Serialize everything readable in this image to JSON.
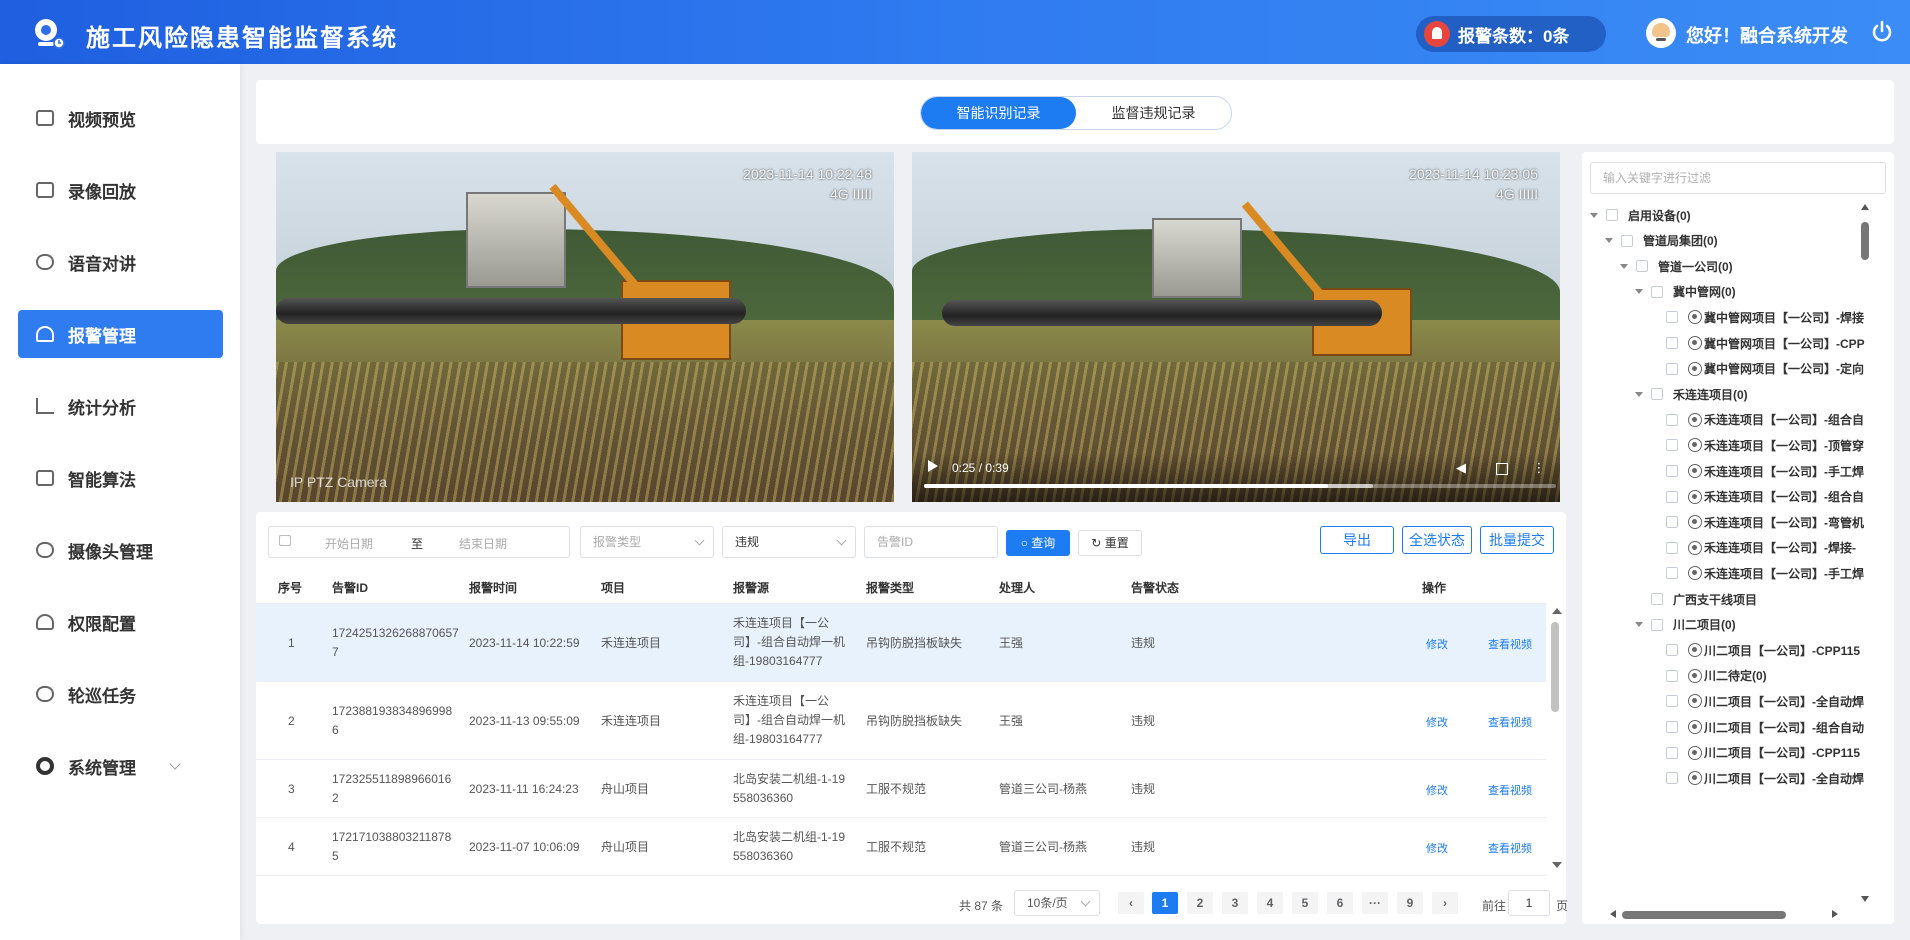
{
  "header": {
    "title": "施工风险隐患智能监督系统",
    "alarm_text": "报警条数：0条",
    "greeting": "您好！融合系统开发"
  },
  "sidebar": {
    "items": [
      {
        "label": "视频预览",
        "icon": "video-preview-icon"
      },
      {
        "label": "录像回放",
        "icon": "playback-icon"
      },
      {
        "label": "语音对讲",
        "icon": "microphone-icon"
      },
      {
        "label": "报警管理",
        "icon": "alarm-icon",
        "active": true
      },
      {
        "label": "统计分析",
        "icon": "bar-chart-icon"
      },
      {
        "label": "智能算法",
        "icon": "code-window-icon"
      },
      {
        "label": "摄像头管理",
        "icon": "camera-icon"
      },
      {
        "label": "权限配置",
        "icon": "user-icon"
      },
      {
        "label": "轮巡任务",
        "icon": "patrol-icon"
      },
      {
        "label": "系统管理",
        "icon": "gear-icon"
      }
    ]
  },
  "tabs": [
    {
      "label": "智能识别记录",
      "active": true
    },
    {
      "label": "监督违规记录",
      "active": false
    }
  ],
  "videos": [
    {
      "timestamp": "2023-11-14 10:22:48",
      "signal": "4G IIIII",
      "label": "IP PTZ Camera"
    },
    {
      "timestamp": "2023-11-14 10:23:05",
      "signal": "4G IIIII",
      "time": "0:25 / 0:39",
      "progress": 0.64,
      "buffered": 0.71
    }
  ],
  "filters": {
    "start_placeholder": "开始日期",
    "range_sep": "至",
    "end_placeholder": "结束日期",
    "type_placeholder": "报警类型",
    "status_value": "违规",
    "id_placeholder": "告警ID",
    "search_label": "查询",
    "reset_label": "重置",
    "export_label": "导出",
    "select_all_label": "全选状态",
    "batch_submit_label": "批量提交"
  },
  "table": {
    "columns": [
      "序号",
      "告警ID",
      "报警时间",
      "项目",
      "报警源",
      "报警类型",
      "处理人",
      "告警状态",
      "操作"
    ],
    "rows": [
      {
        "no": "1",
        "id": [
          "1724251326268870657",
          "7"
        ],
        "time": "2023-11-14 10:22:59",
        "project": "禾连连项目",
        "source": [
          "禾连连项目【一公",
          "司】-组合自动焊一机",
          "组-19803164777"
        ],
        "type": "吊钩防脱挡板缺失",
        "handler": "王强",
        "status": "违规",
        "highlight": true
      },
      {
        "no": "2",
        "id": [
          "172388193834896998",
          "6"
        ],
        "time": "2023-11-13 09:55:09",
        "project": "禾连连项目",
        "source": [
          "禾连连项目【一公",
          "司】-组合自动焊一机",
          "组-19803164777"
        ],
        "type": "吊钩防脱挡板缺失",
        "handler": "王强",
        "status": "违规"
      },
      {
        "no": "3",
        "id": [
          "172325511898966016",
          "2"
        ],
        "time": "2023-11-11 16:24:23",
        "project": "舟山项目",
        "source": [
          "北岛安装二机组-1-19",
          "558036360"
        ],
        "type": "工服不规范",
        "handler": "管道三公司-杨燕",
        "status": "违规"
      },
      {
        "no": "4",
        "id": [
          "172171038803211878",
          "5"
        ],
        "time": "2023-11-07 10:06:09",
        "project": "舟山项目",
        "source": [
          "北岛安装二机组-1-19",
          "558036360"
        ],
        "type": "工服不规范",
        "handler": "管道三公司-杨燕",
        "status": "违规"
      }
    ],
    "op_edit": "修改",
    "op_view": "查看视频"
  },
  "pagination": {
    "total": "共 87 条",
    "page_size": "10条/页",
    "pages": [
      "1",
      "2",
      "3",
      "4",
      "5",
      "6",
      "···",
      "9"
    ],
    "current": "1",
    "goto_label": "前往",
    "goto_value": "1",
    "goto_unit": "页"
  },
  "tree": {
    "search_placeholder": "输入关键字进行过滤",
    "nodes": [
      {
        "label": "启用设备(0)",
        "level": 0,
        "arrow": true
      },
      {
        "label": "管道局集团(0)",
        "level": 1,
        "arrow": true
      },
      {
        "label": "管道一公司(0)",
        "level": 2,
        "arrow": true
      },
      {
        "label": "冀中管网(0)",
        "level": 3,
        "arrow": true
      },
      {
        "label": "冀中管网项目【一公司】-焊接",
        "level": 4,
        "cam": true
      },
      {
        "label": "冀中管网项目【一公司】-CPP",
        "level": 4,
        "cam": true
      },
      {
        "label": "冀中管网项目【一公司】-定向",
        "level": 4,
        "cam": true
      },
      {
        "label": "禾连连项目(0)",
        "level": 3,
        "arrow": true
      },
      {
        "label": "禾连连项目【一公司】-组合自",
        "level": 4,
        "cam": true
      },
      {
        "label": "禾连连项目【一公司】-顶管穿",
        "level": 4,
        "cam": true
      },
      {
        "label": "禾连连项目【一公司】-手工焊",
        "level": 4,
        "cam": true
      },
      {
        "label": "禾连连项目【一公司】-组合自",
        "level": 4,
        "cam": true
      },
      {
        "label": "禾连连项目【一公司】-弯管机",
        "level": 4,
        "cam": true
      },
      {
        "label": "禾连连项目【一公司】-焊接-",
        "level": 4,
        "cam": true
      },
      {
        "label": "禾连连项目【一公司】-手工焊",
        "level": 4,
        "cam": true
      },
      {
        "label": "广西支干线项目",
        "level": 3
      },
      {
        "label": "川二项目(0)",
        "level": 3,
        "arrow": true
      },
      {
        "label": "川二项目【一公司】-CPP115",
        "level": 4,
        "cam": true
      },
      {
        "label": "川二待定(0)",
        "level": 4,
        "cam": true
      },
      {
        "label": "川二项目【一公司】-全自动焊",
        "level": 4,
        "cam": true
      },
      {
        "label": "川二项目【一公司】-组合自动",
        "level": 4,
        "cam": true
      },
      {
        "label": "川二项目【一公司】-CPP115",
        "level": 4,
        "cam": true
      },
      {
        "label": "川二项目【一公司】-全自动焊",
        "level": 4,
        "cam": true
      }
    ]
  },
  "colors": {
    "primary": "#1d7cf2",
    "header_start": "#1f5fe0",
    "alarm_red": "#e8453c"
  }
}
